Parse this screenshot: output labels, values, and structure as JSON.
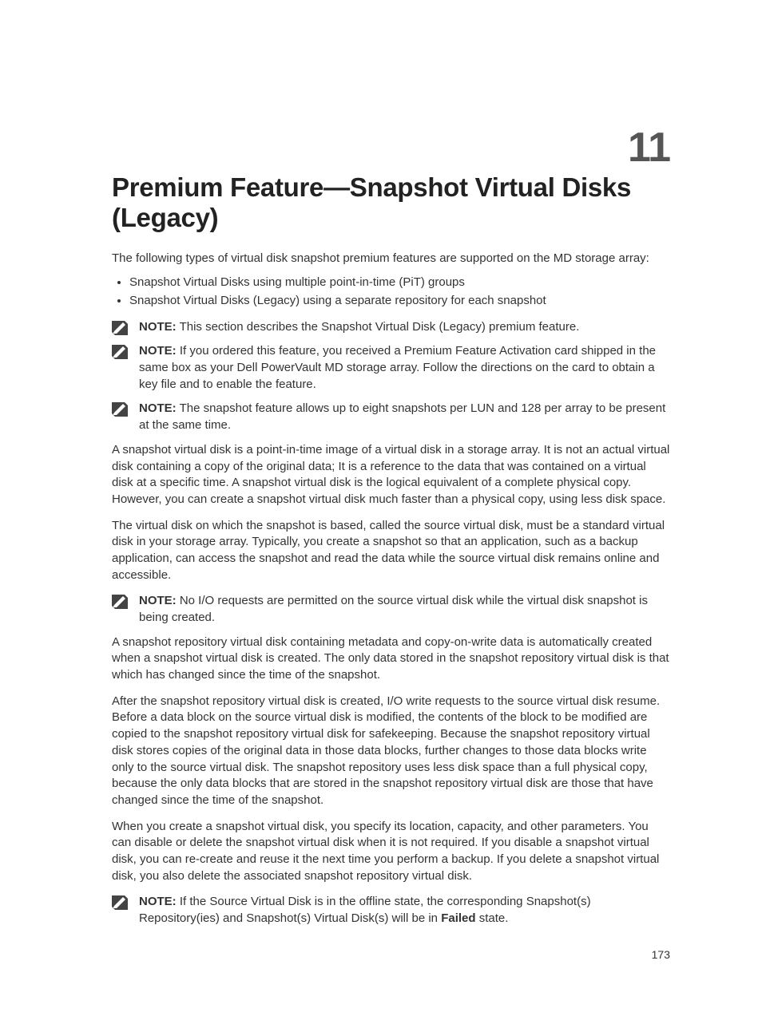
{
  "chapterNumber": "11",
  "title": "Premium Feature—Snapshot Virtual Disks (Legacy)",
  "intro": "The following types of virtual disk snapshot premium features are supported on the MD storage array:",
  "types": [
    "Snapshot Virtual Disks using multiple point-in-time (PiT) groups",
    "Snapshot Virtual Disks (Legacy) using a separate repository for each snapshot"
  ],
  "noteLabel": "NOTE:",
  "notes1": [
    "This section describes the Snapshot Virtual Disk (Legacy) premium feature.",
    "If you ordered this feature, you received a Premium Feature Activation card shipped in the same box as your Dell PowerVault MD storage array. Follow the directions on the card to obtain a key file and to enable the feature.",
    "The snapshot feature allows up to eight snapshots per LUN and 128 per array to be present at the same time."
  ],
  "para1": "A snapshot virtual disk is a point-in-time image of a virtual disk in a storage array. It is not an actual virtual disk containing a copy of the original data; It is a reference to the data that was contained on a virtual disk at a specific time. A snapshot virtual disk is the logical equivalent of a complete physical copy. However, you can create a snapshot virtual disk much faster than a physical copy, using less disk space.",
  "para2": "The virtual disk on which the snapshot is based, called the source virtual disk, must be a standard virtual disk in your storage array. Typically, you create a snapshot so that an application, such as a backup application, can access the snapshot and read the data while the source virtual disk remains online and accessible.",
  "notes2": [
    "No I/O requests are permitted on the source virtual disk while the virtual disk snapshot is being created."
  ],
  "para3": "A snapshot repository virtual disk containing metadata and copy-on-write data is automatically created when a snapshot virtual disk is created. The only data stored in the snapshot repository virtual disk is that which has changed since the time of the snapshot.",
  "para4": "After the snapshot repository virtual disk is created, I/O write requests to the source virtual disk resume. Before a data block on the source virtual disk is modified, the contents of the block to be modified are copied to the snapshot repository virtual disk for safekeeping. Because the snapshot repository virtual disk stores copies of the original data in those data blocks, further changes to those data blocks write only to the source virtual disk. The snapshot repository uses less disk space than a full physical copy, because the only data blocks that are stored in the snapshot repository virtual disk are those that have changed since the time of the snapshot.",
  "para5": "When you create a snapshot virtual disk, you specify its location, capacity, and other parameters. You can disable or delete the snapshot virtual disk when it is not required. If you disable a snapshot virtual disk, you can re-create and reuse it the next time you perform a backup. If you delete a snapshot virtual disk, you also delete the associated snapshot repository virtual disk.",
  "note3Prefix": "If the Source Virtual Disk is in the offline state, the corresponding Snapshot(s) Repository(ies) and Snapshot(s) Virtual Disk(s) will be in ",
  "note3Bold": "Failed",
  "note3Suffix": " state.",
  "pageNumber": "173"
}
